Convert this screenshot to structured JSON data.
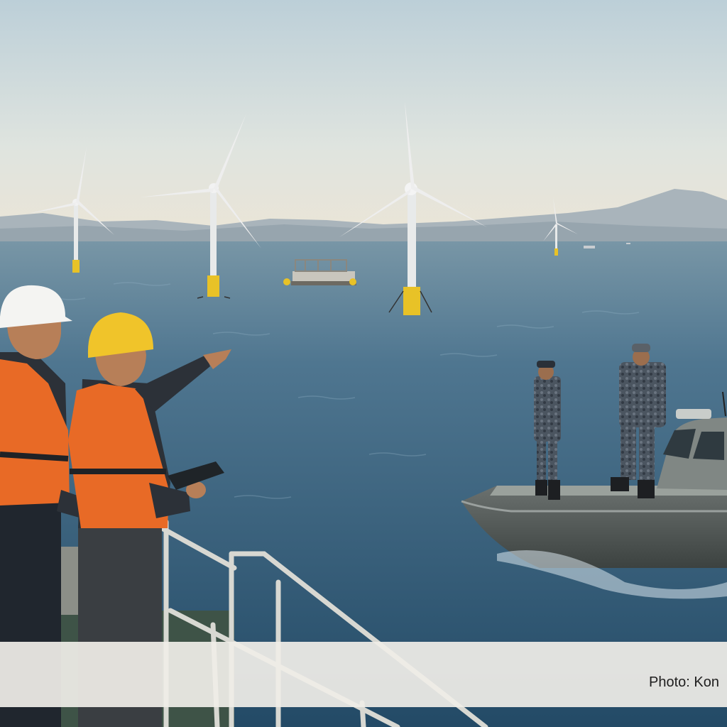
{
  "caption": {
    "text": "Photo: Kon"
  }
}
